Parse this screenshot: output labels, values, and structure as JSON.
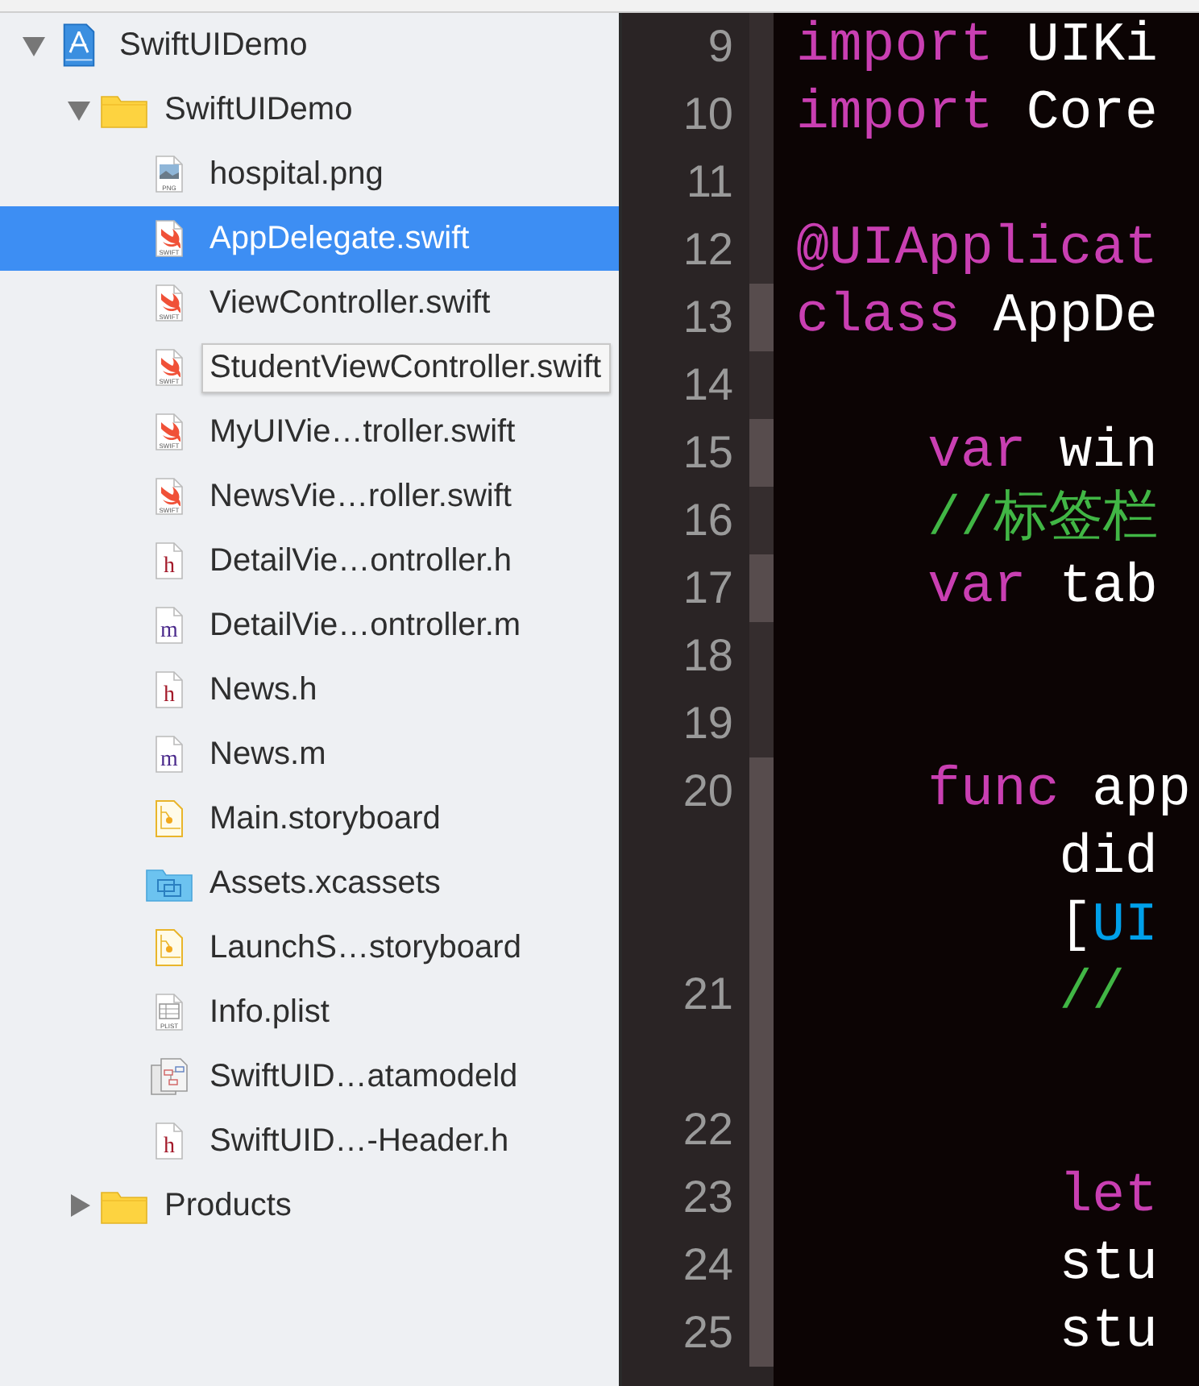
{
  "navigator": {
    "items": [
      {
        "label": "SwiftUIDemo",
        "kind": "project",
        "selected": false,
        "expanded": true,
        "children": [
          {
            "label": "SwiftUIDemo",
            "kind": "folder",
            "selected": false,
            "expanded": true,
            "children": [
              {
                "label": "hospital.png",
                "kind": "png",
                "icon_label": "PNG",
                "selected": false
              },
              {
                "label": "AppDelegate.swift",
                "kind": "swift",
                "icon_label": "SWIFT",
                "selected": true
              },
              {
                "label": "ViewController.swift",
                "kind": "swift",
                "icon_label": "SWIFT",
                "selected": false
              },
              {
                "label": "StudentViewController.swift",
                "kind": "swift",
                "icon_label": "SWIFT",
                "selected": false,
                "tooltip": true
              },
              {
                "label": "MyUIVie…troller.swift",
                "kind": "swift",
                "icon_label": "SWIFT",
                "selected": false
              },
              {
                "label": "NewsVie…roller.swift",
                "kind": "swift",
                "icon_label": "SWIFT",
                "selected": false
              },
              {
                "label": "DetailVie…ontroller.h",
                "kind": "source",
                "icon_letter": "h",
                "selected": false
              },
              {
                "label": "DetailVie…ontroller.m",
                "kind": "source",
                "icon_letter": "m",
                "selected": false
              },
              {
                "label": "News.h",
                "kind": "source",
                "icon_letter": "h",
                "selected": false
              },
              {
                "label": "News.m",
                "kind": "source",
                "icon_letter": "m",
                "selected": false
              },
              {
                "label": "Main.storyboard",
                "kind": "storyboard",
                "selected": false
              },
              {
                "label": "Assets.xcassets",
                "kind": "assets",
                "selected": false
              },
              {
                "label": "LaunchS…storyboard",
                "kind": "storyboard",
                "selected": false
              },
              {
                "label": "Info.plist",
                "kind": "plist",
                "icon_label": "PLIST",
                "selected": false
              },
              {
                "label": "SwiftUID…atamodeld",
                "kind": "datamodel",
                "selected": false
              },
              {
                "label": "SwiftUID…-Header.h",
                "kind": "source",
                "icon_letter": "h",
                "selected": false
              }
            ]
          },
          {
            "label": "Products",
            "kind": "folder",
            "selected": false,
            "expanded": false
          }
        ]
      }
    ]
  },
  "editor": {
    "lines": [
      {
        "number": "9",
        "changed": false,
        "rows": [
          [
            {
              "kind": "keyword",
              "text": "import"
            },
            {
              "kind": "plain",
              "text": " UIKi"
            }
          ]
        ]
      },
      {
        "number": "10",
        "changed": false,
        "rows": [
          [
            {
              "kind": "keyword",
              "text": "import"
            },
            {
              "kind": "plain",
              "text": " Core"
            }
          ]
        ]
      },
      {
        "number": "11",
        "changed": false,
        "rows": [
          []
        ]
      },
      {
        "number": "12",
        "changed": false,
        "rows": [
          [
            {
              "kind": "keyword",
              "text": "@UIApplicat"
            }
          ]
        ]
      },
      {
        "number": "13",
        "changed": true,
        "rows": [
          [
            {
              "kind": "keyword",
              "text": "class"
            },
            {
              "kind": "plain",
              "text": " AppDe"
            }
          ]
        ]
      },
      {
        "number": "14",
        "changed": false,
        "rows": [
          []
        ]
      },
      {
        "number": "15",
        "changed": true,
        "rows": [
          [
            {
              "kind": "keyword",
              "text": "    var"
            },
            {
              "kind": "plain",
              "text": " win"
            }
          ]
        ]
      },
      {
        "number": "16",
        "changed": false,
        "rows": [
          [
            {
              "kind": "comment",
              "text": "    //标签栏"
            }
          ]
        ]
      },
      {
        "number": "17",
        "changed": true,
        "rows": [
          [
            {
              "kind": "keyword",
              "text": "    var"
            },
            {
              "kind": "plain",
              "text": " tab"
            }
          ]
        ]
      },
      {
        "number": "18",
        "changed": false,
        "rows": [
          []
        ]
      },
      {
        "number": "19",
        "changed": false,
        "rows": [
          []
        ]
      },
      {
        "number": "20",
        "changed": true,
        "rows": [
          [
            {
              "kind": "keyword",
              "text": "    func"
            },
            {
              "kind": "plain",
              "text": " app"
            }
          ],
          [
            {
              "kind": "plain",
              "text": "        did"
            }
          ],
          [
            {
              "kind": "plain",
              "text": "        ["
            },
            {
              "kind": "type",
              "text": "UI"
            }
          ]
        ]
      },
      {
        "number": "21",
        "changed": true,
        "rows": [
          [
            {
              "kind": "comment",
              "text": "        //"
            }
          ],
          []
        ]
      },
      {
        "number": "22",
        "changed": true,
        "rows": [
          []
        ]
      },
      {
        "number": "23",
        "changed": true,
        "rows": [
          [
            {
              "kind": "keyword",
              "text": "        let"
            }
          ]
        ]
      },
      {
        "number": "24",
        "changed": true,
        "rows": [
          [
            {
              "kind": "plain",
              "text": "        stu"
            }
          ]
        ]
      },
      {
        "number": "25",
        "changed": true,
        "rows": [
          [
            {
              "kind": "plain",
              "text": "        stu"
            }
          ]
        ]
      }
    ]
  }
}
